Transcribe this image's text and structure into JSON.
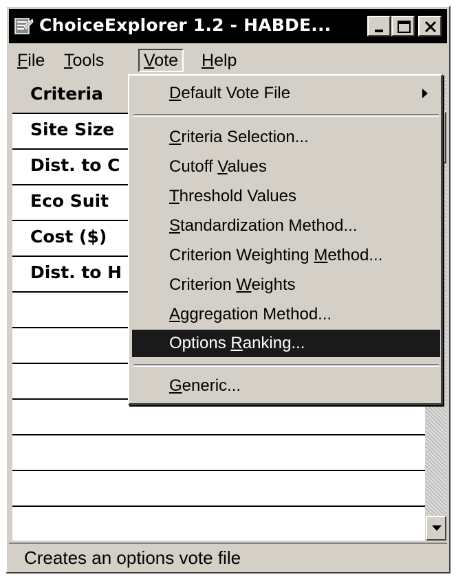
{
  "window": {
    "title": "ChoiceExplorer 1.2 - HABDE...",
    "icon": "app-icon"
  },
  "menubar": {
    "items": [
      {
        "pre": "",
        "u": "F",
        "post": "ile"
      },
      {
        "pre": "",
        "u": "T",
        "post": "ools"
      },
      {
        "pre": "",
        "u": "V",
        "post": "ote"
      },
      {
        "pre": "",
        "u": "H",
        "post": "elp"
      }
    ]
  },
  "grid": {
    "header": "Criteria",
    "rows": [
      "Site Size",
      "Dist. to C",
      "Eco Suit",
      "Cost ($)",
      "Dist. to H"
    ]
  },
  "vote_menu": {
    "items": [
      {
        "pre": "",
        "u": "D",
        "post": "efault Vote File",
        "submenu": true
      },
      {
        "pre": "",
        "u": "C",
        "post": "riteria Selection..."
      },
      {
        "pre": "Cutoff ",
        "u": "V",
        "post": "alues"
      },
      {
        "pre": "",
        "u": "T",
        "post": "hreshold Values"
      },
      {
        "pre": "",
        "u": "S",
        "post": "tandardization Method..."
      },
      {
        "pre": "Criterion Weighting ",
        "u": "M",
        "post": "ethod..."
      },
      {
        "pre": "Criterion ",
        "u": "W",
        "post": "eights"
      },
      {
        "pre": "",
        "u": "A",
        "post": "ggregation Method..."
      },
      {
        "pre": "Options ",
        "u": "R",
        "post": "anking...",
        "highlighted": true
      },
      {
        "pre": "",
        "u": "G",
        "post": "eneric..."
      }
    ]
  },
  "status": {
    "text": "Creates an options vote file"
  },
  "colors": {
    "titlebar": "#000000",
    "face": "#d4d0c8",
    "highlight": "#1a1a1a"
  }
}
